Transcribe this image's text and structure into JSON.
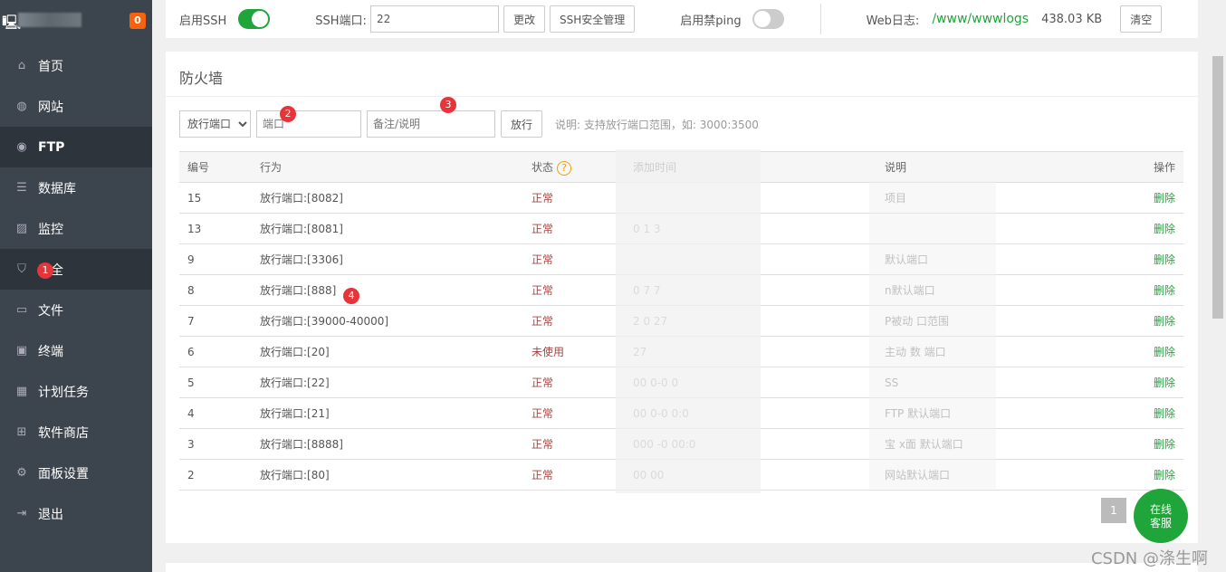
{
  "sidebar": {
    "badge": "0",
    "items": [
      {
        "label": "首页",
        "icon": "home-icon"
      },
      {
        "label": "网站",
        "icon": "globe-icon"
      },
      {
        "label": "FTP",
        "icon": "ftp-icon"
      },
      {
        "label": "数据库",
        "icon": "database-icon"
      },
      {
        "label": "监控",
        "icon": "monitor-icon"
      },
      {
        "label": "安全",
        "icon": "shield-icon"
      },
      {
        "label": "文件",
        "icon": "folder-icon"
      },
      {
        "label": "终端",
        "icon": "terminal-icon"
      },
      {
        "label": "计划任务",
        "icon": "calendar-icon"
      },
      {
        "label": "软件商店",
        "icon": "grid-icon"
      },
      {
        "label": "面板设置",
        "icon": "gear-icon"
      },
      {
        "label": "退出",
        "icon": "logout-icon"
      }
    ]
  },
  "top": {
    "ssh_label": "启用SSH",
    "ssh_enabled": true,
    "ssh_port_label": "SSH端口:",
    "ssh_port": "22",
    "change": "更改",
    "ssh_manage": "SSH安全管理",
    "ping_label": "启用禁ping",
    "ping_enabled": false,
    "weblog_label": "Web日志:",
    "weblog_path": "/www/wwwlogs",
    "weblog_size": "438.03 KB",
    "clear": "清空"
  },
  "firewall": {
    "title": "防火墙",
    "select": "放行端口",
    "port_placeholder": "端口",
    "note_placeholder": "备注/说明",
    "submit": "放行",
    "hint": "说明: 支持放行端口范围，如: 3000:3500",
    "headers": [
      "编号",
      "行为",
      "状态",
      "添加时间",
      "说明",
      "操作"
    ],
    "rows": [
      {
        "id": "15",
        "action": "放行端口:[8082]",
        "status": "正常",
        "time": "",
        "desc": "项目",
        "op": "删除"
      },
      {
        "id": "13",
        "action": "放行端口:[8081]",
        "status": "正常",
        "time": "0  1        3",
        "desc": "",
        "op": "删除"
      },
      {
        "id": "9",
        "action": "放行端口:[3306]",
        "status": "正常",
        "time": "",
        "desc": "默认端口",
        "op": "删除"
      },
      {
        "id": "8",
        "action": "放行端口:[888]",
        "status": "正常",
        "time": "0  7      7",
        "desc": "n默认端口",
        "op": "删除"
      },
      {
        "id": "7",
        "action": "放行端口:[39000-40000]",
        "status": "正常",
        "time": "2    0      27",
        "desc": "P被动  口范围",
        "op": "删除"
      },
      {
        "id": "6",
        "action": "放行端口:[20]",
        "status": "未使用",
        "time": "27",
        "desc": "主动  数  端口",
        "op": "删除"
      },
      {
        "id": "5",
        "action": "放行端口:[22]",
        "status": "正常",
        "time": "00  0-0  0",
        "desc": "SS",
        "op": "删除"
      },
      {
        "id": "4",
        "action": "放行端口:[21]",
        "status": "正常",
        "time": "00  0-0  0:0",
        "desc": "FTP  默认端口",
        "op": "删除"
      },
      {
        "id": "3",
        "action": "放行端口:[8888]",
        "status": "正常",
        "time": "000 -0   00:0",
        "desc": "宝  x面  默认端口",
        "op": "删除"
      },
      {
        "id": "2",
        "action": "放行端口:[80]",
        "status": "正常",
        "time": "00  00",
        "desc": "网站默认端口",
        "op": "删除"
      }
    ]
  },
  "pager": {
    "page": "1"
  },
  "chat": {
    "line1": "在线",
    "line2": "客服"
  },
  "markers": [
    "1",
    "2",
    "3",
    "4"
  ],
  "watermark": "CSDN @涤生啊"
}
